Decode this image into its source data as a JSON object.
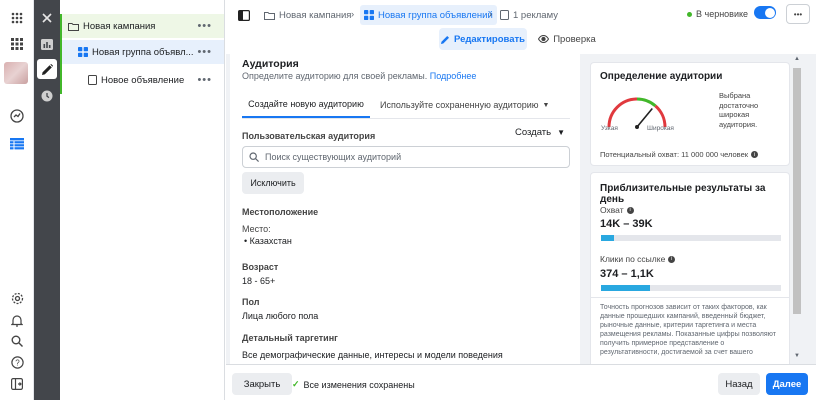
{
  "colors": {
    "accent": "#1877f2",
    "saved": "#42b72a",
    "gauge_green": "#42b72a",
    "gauge_red": "#e0393e",
    "bar_fill": "#29a8e0",
    "tool_rail": "#43464b"
  },
  "rail_icons": [
    "grid-icon",
    "apps-icon",
    "avatar",
    "dashboard-icon",
    "table-icon",
    "settings-icon",
    "bell-icon",
    "search-icon",
    "help-icon",
    "sidebar-toggle-icon"
  ],
  "tree": {
    "campaign": "Новая кампания",
    "adset": "Новая группа объявл...",
    "ad": "Новое объявление"
  },
  "header": {
    "crumb_campaign": "Новая кампания",
    "crumb_adset": "Новая группа объявлений",
    "crumb_ad": "1 рекламу",
    "draft_label": "В черновике",
    "more": "•••",
    "edit_label": "Редактировать",
    "review_label": "Проверка"
  },
  "audience": {
    "title": "Аудитория",
    "subtitle": "Определите аудиторию для своей рекламы.",
    "more_link": "Подробнее",
    "tab_new": "Создайте новую аудиторию",
    "tab_saved": "Используйте сохраненную аудиторию",
    "custom_label": "Пользовательская аудитория",
    "create_label": "Создать",
    "search_placeholder": "Поиск существующих аудиторий",
    "exclude_label": "Исключить",
    "location_title": "Местоположение",
    "place_label": "Место:",
    "place_value": "Казахстан",
    "age_title": "Возраст",
    "age_value": "18 - 65+",
    "gender_title": "Пол",
    "gender_value": "Лица любого пола",
    "targeting_title": "Детальный таргетинг",
    "targeting_value": "Все демографические данные, интересы и модели поведения"
  },
  "definition": {
    "title": "Определение аудитории",
    "narrow": "Узкая",
    "wide": "Широкая",
    "desc": "Выбрана достаточно широкая аудитория.",
    "reach": "Потенциальный охват: 11 000 000 человек",
    "gauge_level": 0.72
  },
  "results": {
    "title": "Приблизительные результаты за день",
    "reach_label": "Охват",
    "reach_value": "14K – 39K",
    "reach_fill": 0.07,
    "clicks_label": "Клики по ссылке",
    "clicks_value": "374 – 1,1K",
    "clicks_fill": 0.27,
    "note": "Точность прогнозов зависит от таких факторов, как данные прошедших кампаний, введенный бюджет, рыночные данные, критерии таргетинга и места размещения рекламы. Показанные цифры позволяют получить примерное представление о результативности, достигаемой за счет вашего"
  },
  "footer": {
    "close_label": "Закрыть",
    "saved_label": "Все изменения сохранены",
    "back_label": "Назад",
    "next_label": "Далее"
  }
}
